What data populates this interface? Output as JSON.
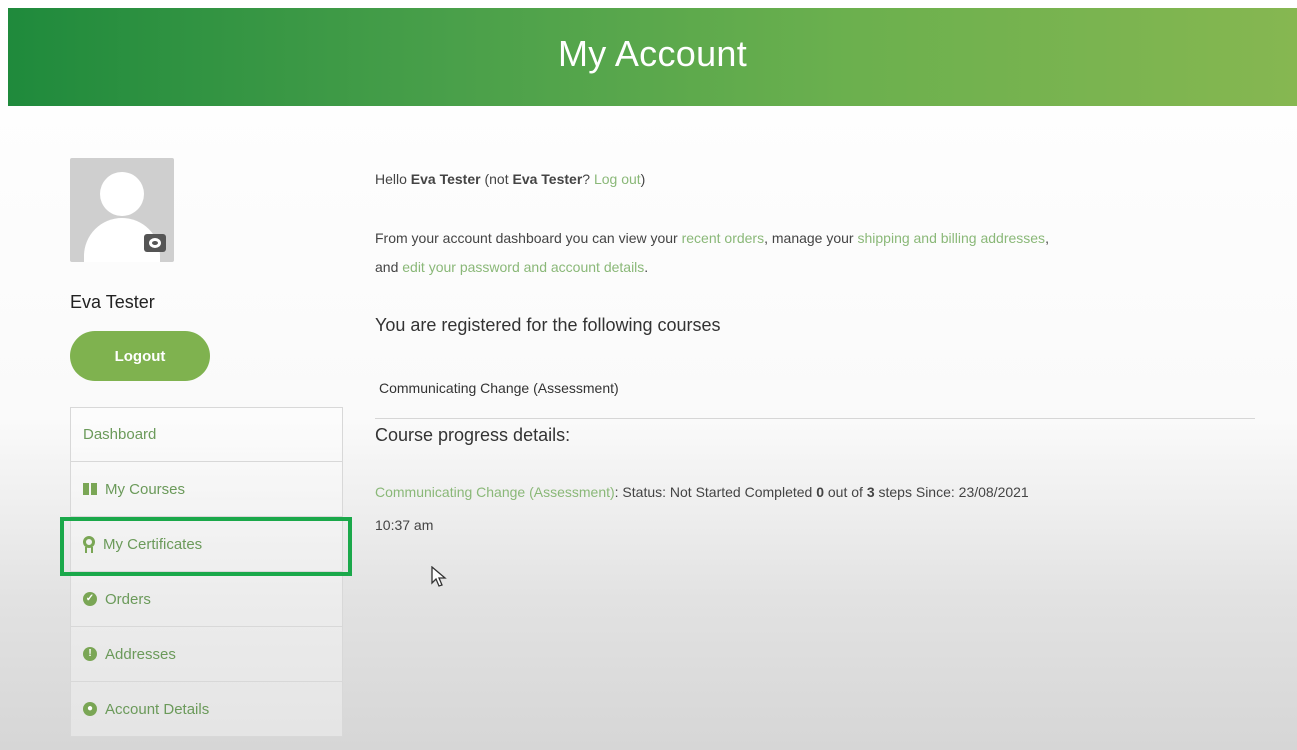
{
  "header": {
    "title": "My Account"
  },
  "profile": {
    "name": "Eva Tester",
    "logout_label": "Logout"
  },
  "nav": {
    "items": [
      {
        "label": "Dashboard",
        "icon": ""
      },
      {
        "label": "My Courses",
        "icon": "book-icon"
      },
      {
        "label": "My Certificates",
        "icon": "medal-icon"
      },
      {
        "label": "Orders",
        "icon": "check-circle-icon"
      },
      {
        "label": "Addresses",
        "icon": "info-circle-icon"
      },
      {
        "label": "Account Details",
        "icon": "user-circle-icon"
      }
    ],
    "highlighted_item": "My Certificates",
    "highlight_color": "#1aa84a"
  },
  "greeting": {
    "hello": "Hello",
    "name": "Eva Tester",
    "not_prefix": "(not",
    "not_name": "Eva Tester",
    "question": "?",
    "logout_link": "Log out",
    "close": ")"
  },
  "intro": {
    "part1": "From your account dashboard you can view your",
    "recent_orders": "recent orders",
    "part2": ", manage your",
    "addresses_link": "shipping and billing addresses",
    "part3": ",",
    "part4": "and",
    "account_link": "edit your password and account details",
    "part5": "."
  },
  "courses": {
    "heading": "You are registered for the following courses",
    "items": [
      "Communicating Change (Assessment)"
    ]
  },
  "progress": {
    "heading": "Course progress details:",
    "course_link": "Communicating Change (Assessment)",
    "status_text": ": Status: Not Started Completed",
    "completed": "0",
    "out_of": "out of",
    "total": "3",
    "steps_since": "steps Since: 23/08/2021",
    "time": "10:37 am"
  },
  "colors": {
    "header_start": "#1f8a3c",
    "header_end": "#86b751",
    "accent": "#7fb24f",
    "link": "#8ab878"
  }
}
